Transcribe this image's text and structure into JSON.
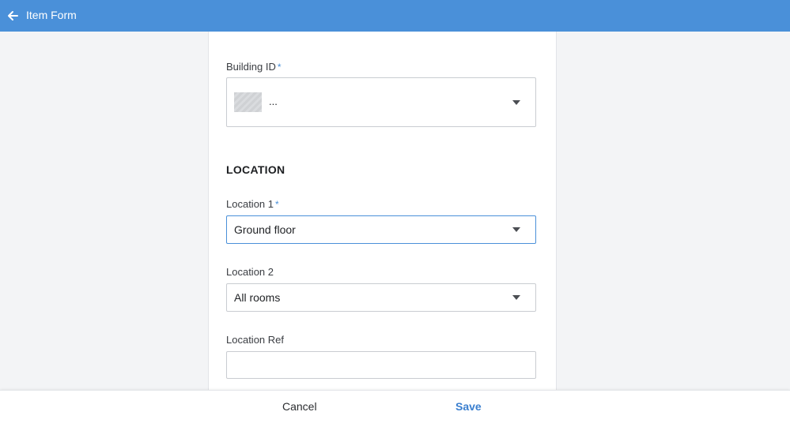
{
  "header": {
    "title": "Item Form",
    "back_icon": "arrow-left-icon"
  },
  "form": {
    "building": {
      "label": "Building ID",
      "required_mark": "*",
      "value": "..."
    },
    "location_section": {
      "heading": "LOCATION"
    },
    "location1": {
      "label": "Location 1",
      "required_mark": "*",
      "value": "Ground floor"
    },
    "location2": {
      "label": "Location 2",
      "value": "All rooms"
    },
    "location_ref": {
      "label": "Location Ref",
      "value": ""
    }
  },
  "footer": {
    "cancel_label": "Cancel",
    "save_label": "Save"
  },
  "colors": {
    "header_bg": "#4a90d9",
    "accent": "#4a90d9",
    "save_text": "#3a7fcf"
  }
}
